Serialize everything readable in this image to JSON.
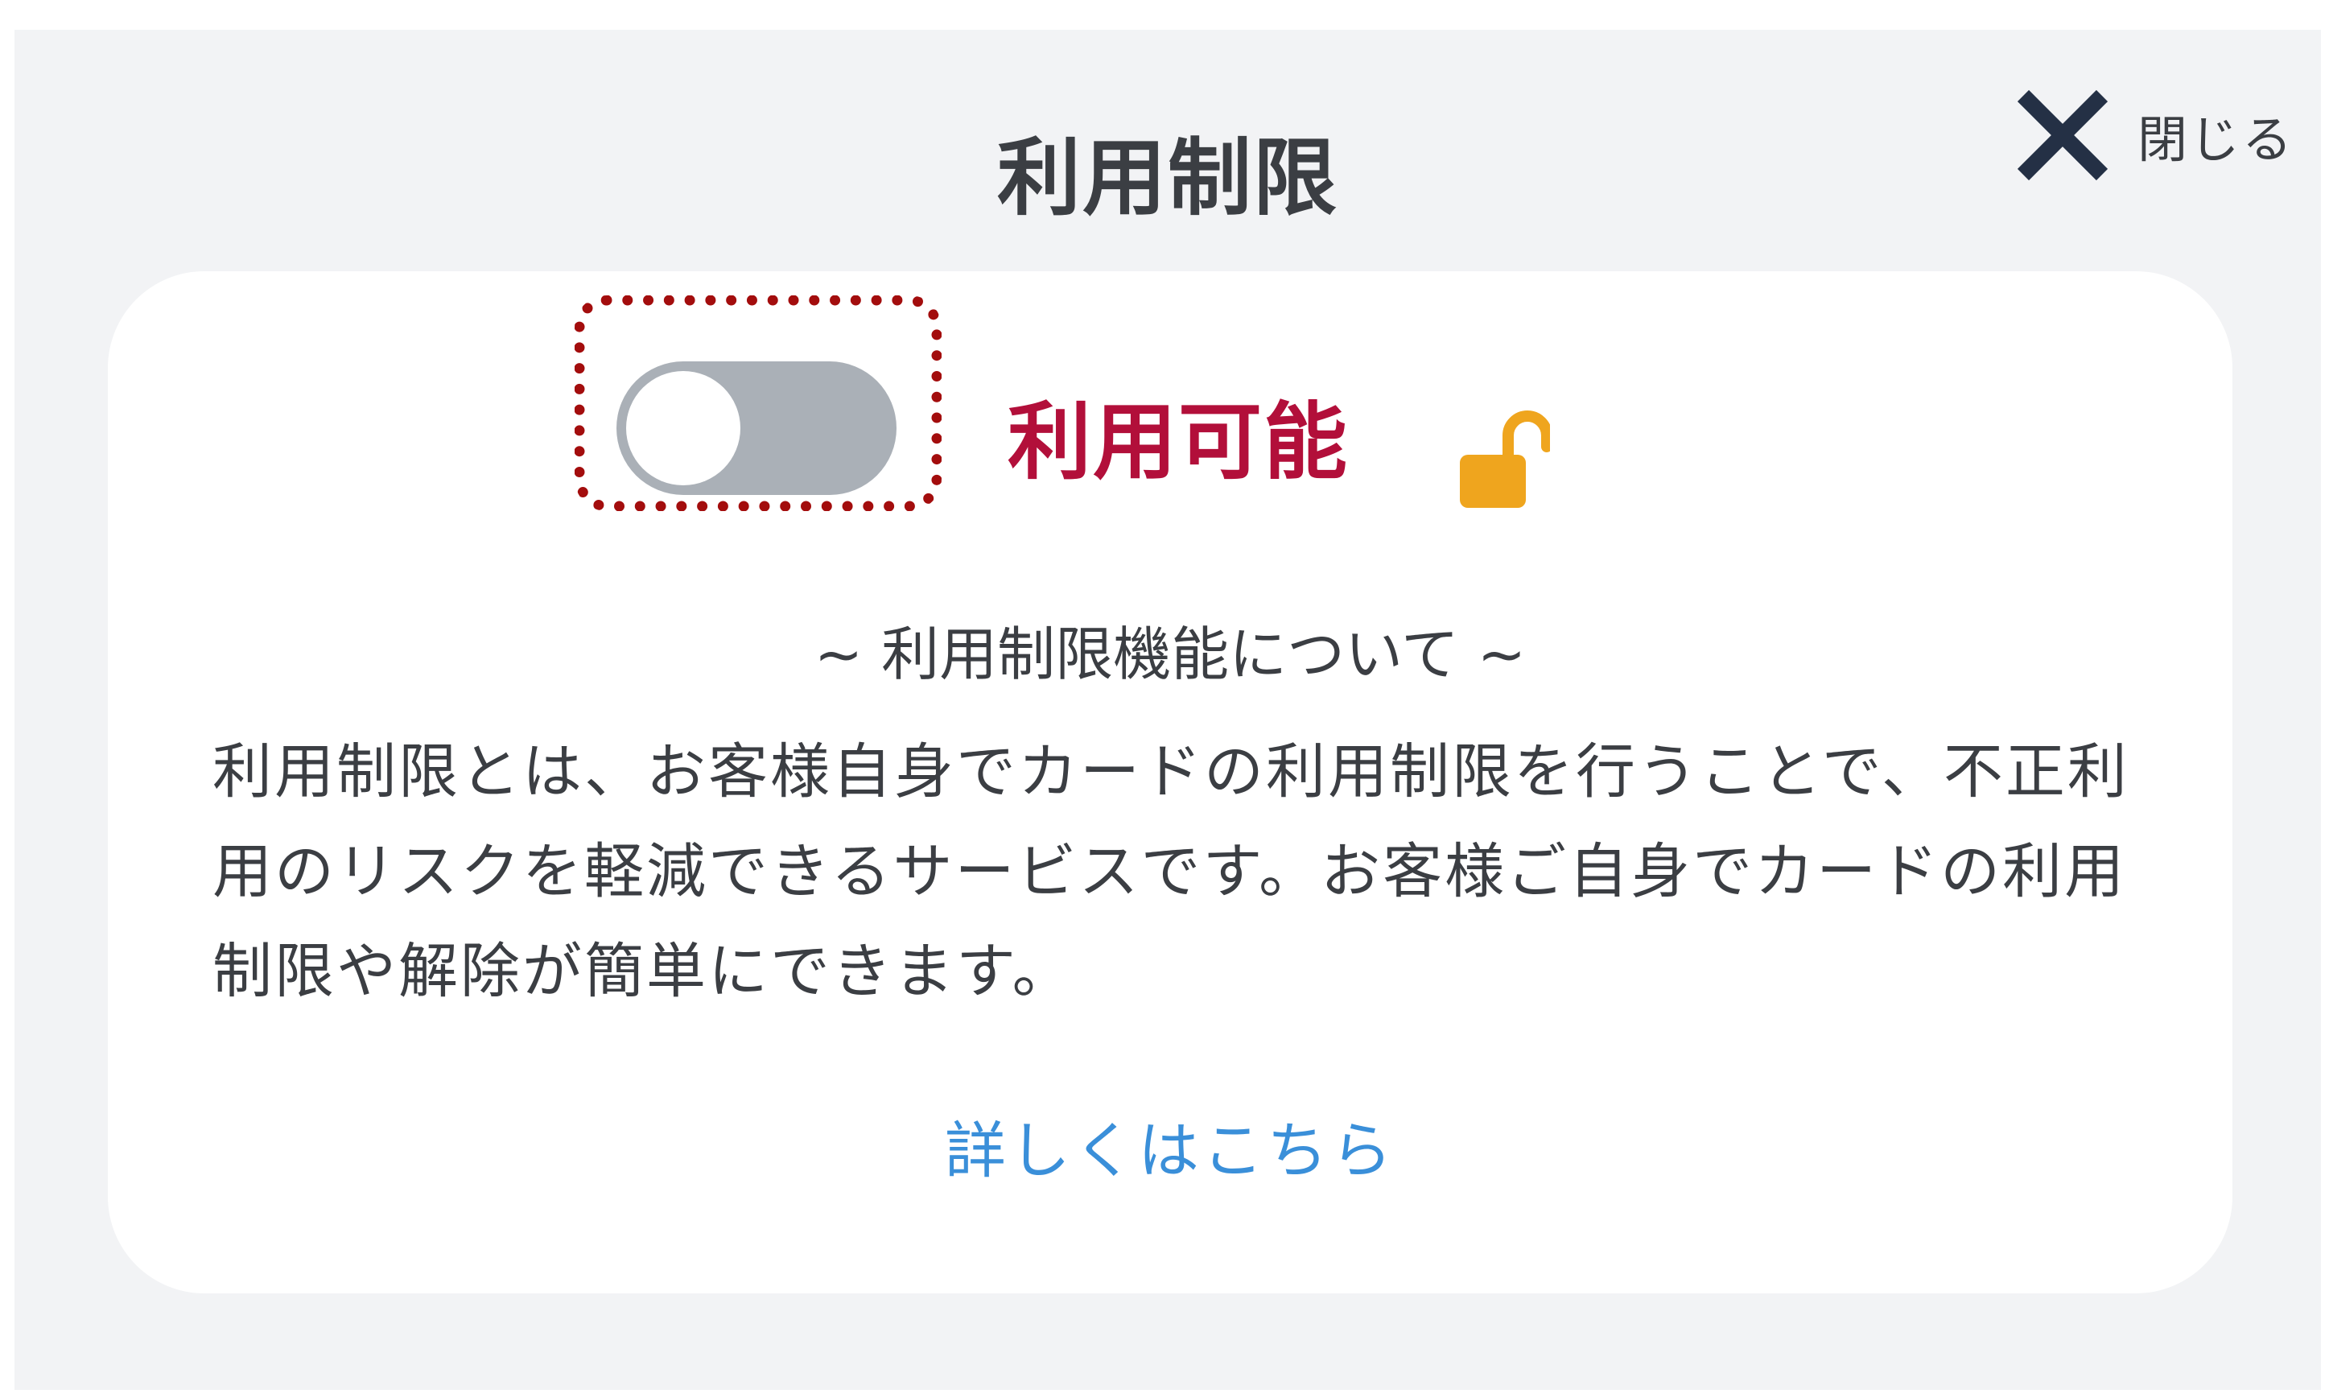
{
  "header": {
    "title": "利用制限",
    "close_label": "閉じる"
  },
  "status": {
    "toggle_on": false,
    "label": "利用可能",
    "lock_icon": "unlocked-padlock-icon"
  },
  "about": {
    "heading": "~ 利用制限機能について ~",
    "description": "利用制限とは、お客様自身でカードの利用制限を行うことで、不正利用のリスクを軽減できるサービスです。お客様ご自身でカードの利用制限や解除が簡単にできます。",
    "link_label": "詳しくはこちら"
  },
  "colors": {
    "background": "#f2f3f5",
    "card": "#ffffff",
    "status_text": "#b20f3a",
    "toggle_off": "#aab0b7",
    "lock": "#efa51e",
    "link": "#3a8fd9",
    "focus_outline": "#a30d0d",
    "close_icon": "#243045"
  }
}
